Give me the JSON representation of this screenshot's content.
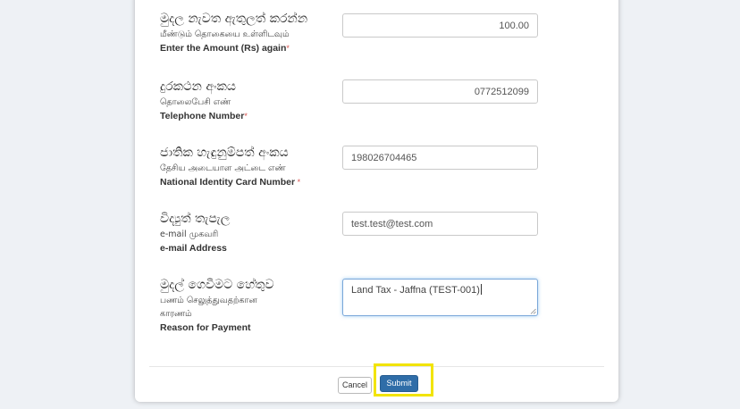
{
  "fields": [
    {
      "label_si": "මුදල නැවත ඇතුලත් කරන්න",
      "label_ta": "மீண்டும் தொகையை உள்ளிடவும்",
      "label_en": "Enter the Amount (Rs) again",
      "required": "*",
      "value": "100.00"
    },
    {
      "label_si": "දුරකථන අංකය",
      "label_ta": "தொலைபேசி எண்",
      "label_en": "Telephone Number",
      "required": "*",
      "value": "0772512099"
    },
    {
      "label_si": "ජාතික හැඳුනුම්පත් අංකය",
      "label_ta": "தேசிய அடையாள அட்டை எண்",
      "label_en": "National Identity Card Number",
      "required": " *",
      "value": "198026704465"
    },
    {
      "label_si": "විද්‍යුත් තැපැල",
      "label_ta": "e-mail முகவரி",
      "label_en": "e-mail Address",
      "value": "test.test@test.com"
    },
    {
      "label_si": "මුදල් ගෙවීමට හේතුව",
      "label_ta_line1": "பணம் செலுத்துவதற்கான",
      "label_ta_line2": "காரணம்",
      "label_en": "Reason for Payment",
      "value": "Land Tax - Jaffna (TEST-001)"
    }
  ],
  "actions": {
    "cancel_label": "Cancel",
    "submit_label": "Submit"
  },
  "colors": {
    "primary": "#2f6da8",
    "required": "#d9534f",
    "highlight": "#f2e400",
    "focus_border": "#7aa7d9"
  }
}
